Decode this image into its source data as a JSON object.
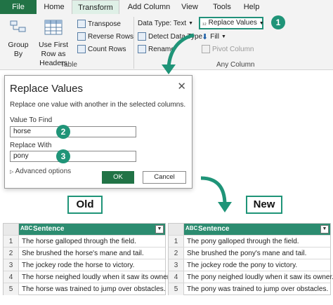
{
  "tabs": [
    "File",
    "Home",
    "Transform",
    "Add Column",
    "View",
    "Tools",
    "Help"
  ],
  "ribbon": {
    "group_by": "Group By",
    "use_first_row": "Use First Row as Headers",
    "transpose": "Transpose",
    "reverse_rows": "Reverse Rows",
    "count_rows": "Count Rows",
    "table_group": "Table",
    "data_type": "Data Type: Text",
    "detect_type": "Detect Data Type",
    "rename": "Rename",
    "replace_values": "Replace Values",
    "fill": "Fill",
    "pivot_column": "Pivot Column",
    "any_column_group": "Any Column"
  },
  "steps": [
    "1",
    "2",
    "3"
  ],
  "dialog": {
    "title": "Replace Values",
    "close": "✕",
    "description": "Replace one value with another in the selected columns.",
    "find_label": "Value To Find",
    "find_value": "horse",
    "replace_label": "Replace With",
    "replace_value": "pony",
    "advanced": "Advanced options",
    "ok": "OK",
    "cancel": "Cancel"
  },
  "old_label": "Old",
  "new_label": "New",
  "old_table": {
    "header": "Sentence",
    "type_icon": "ABC",
    "rows": [
      {
        "n": "1",
        "text": "The horse galloped through the field."
      },
      {
        "n": "2",
        "text": "She brushed the horse's mane and tail."
      },
      {
        "n": "3",
        "text": "The jockey rode the horse to victory."
      },
      {
        "n": "4",
        "text": "The horse neighed loudly when it saw its owner."
      },
      {
        "n": "5",
        "text": "The horse was trained to jump over obstacles."
      }
    ]
  },
  "new_table": {
    "header": "Sentence",
    "type_icon": "ABC",
    "rows": [
      {
        "n": "1",
        "text": "The pony galloped through the field."
      },
      {
        "n": "2",
        "text": "She brushed the pony's mane and tail."
      },
      {
        "n": "3",
        "text": "The jockey rode the pony to victory."
      },
      {
        "n": "4",
        "text": "The pony neighed loudly when it saw its owner."
      },
      {
        "n": "5",
        "text": "The pony was trained to jump over obstacles."
      }
    ]
  },
  "colors": {
    "accent": "#217346",
    "teal": "#1f9478",
    "header": "#2c8c70"
  }
}
